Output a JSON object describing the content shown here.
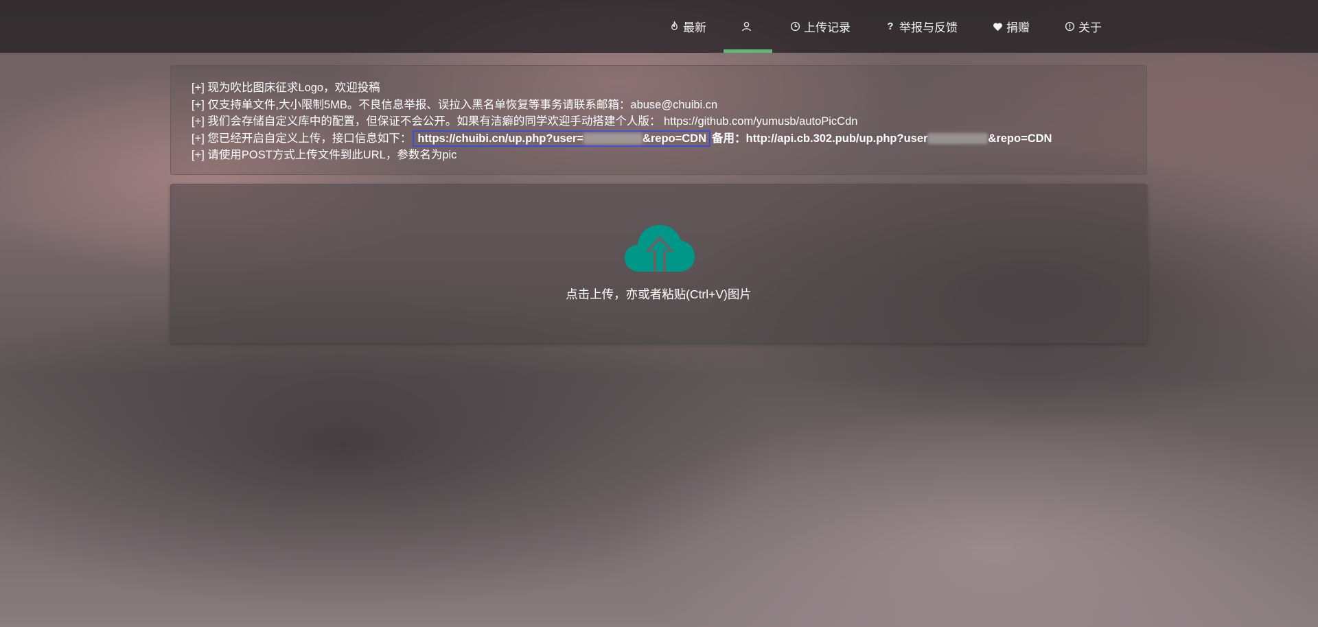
{
  "nav": {
    "items": [
      {
        "label": "最新",
        "icon": "flame-icon"
      },
      {
        "label": "",
        "icon": "user-icon",
        "active": true
      },
      {
        "label": "上传记录",
        "icon": "clock-icon"
      },
      {
        "label": "举报与反馈",
        "icon": "question-icon"
      },
      {
        "label": "捐赠",
        "icon": "heart-icon"
      },
      {
        "label": "关于",
        "icon": "info-icon"
      }
    ],
    "accent_color": "#5fb878"
  },
  "info": {
    "line1": "[+] 现为吹比图床征求Logo，欢迎投稿",
    "line2": "[+] 仅支持单文件,大小限制5MB。不良信息举报、误拉入黑名单恢复等事务请联系邮箱：abuse@chuibi.cn",
    "line3": "[+] 我们会存储自定义库中的配置，但保证不会公开。如果有洁癖的同学欢迎手动搭建个人版： https://github.com/yumusb/autoPicCdn",
    "line4_prefix": "[+] 您已经开启自定义上传，接口信息如下：",
    "line4_url_start": "https://chuibi.cn/up.php?user=",
    "line4_url_end": "&repo=CDN",
    "line4_backup_label": "备用：",
    "line4_backup_start": "http://api.cb.302.pub/up.php?user",
    "line4_backup_end": "&repo=CDN",
    "line5": "[+] 请使用POST方式上传文件到此URL，参数名为pic"
  },
  "upload": {
    "text": "点击上传，亦或者粘贴(Ctrl+V)图片",
    "icon": "cloud-upload-icon",
    "icon_color": "#009688"
  }
}
